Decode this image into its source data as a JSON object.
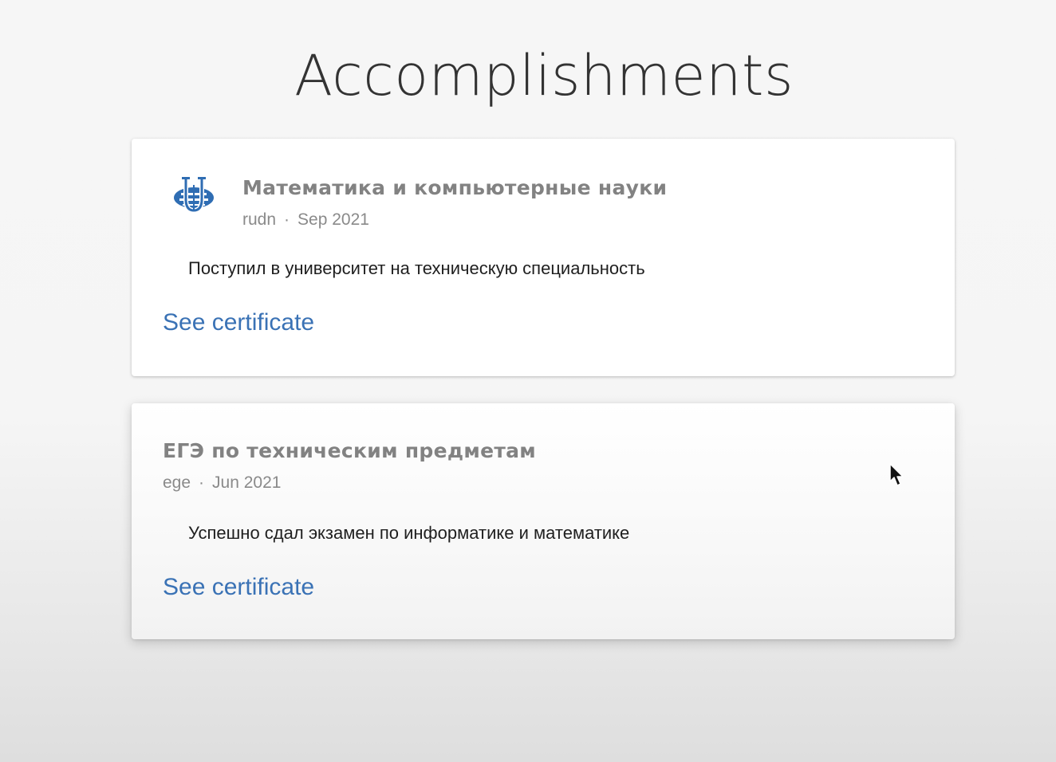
{
  "page": {
    "title": "Accomplishments"
  },
  "accomplishments": [
    {
      "title": "Математика и компьютерные науки",
      "issuer": "rudn",
      "separator": "·",
      "date": "Sep 2021",
      "description": "Поступил в университет на техническую специальность",
      "link_label": "See certificate",
      "logo_icon": "university-globe-icon"
    },
    {
      "title": "ЕГЭ по техническим предметам",
      "issuer": "ege",
      "separator": "·",
      "date": "Jun 2021",
      "description": "Успешно сдал экзамен по информатике и математике",
      "link_label": "See certificate"
    }
  ],
  "colors": {
    "link": "#3a72b5",
    "title_gray": "#828282",
    "logo_blue": "#2f6db3"
  }
}
